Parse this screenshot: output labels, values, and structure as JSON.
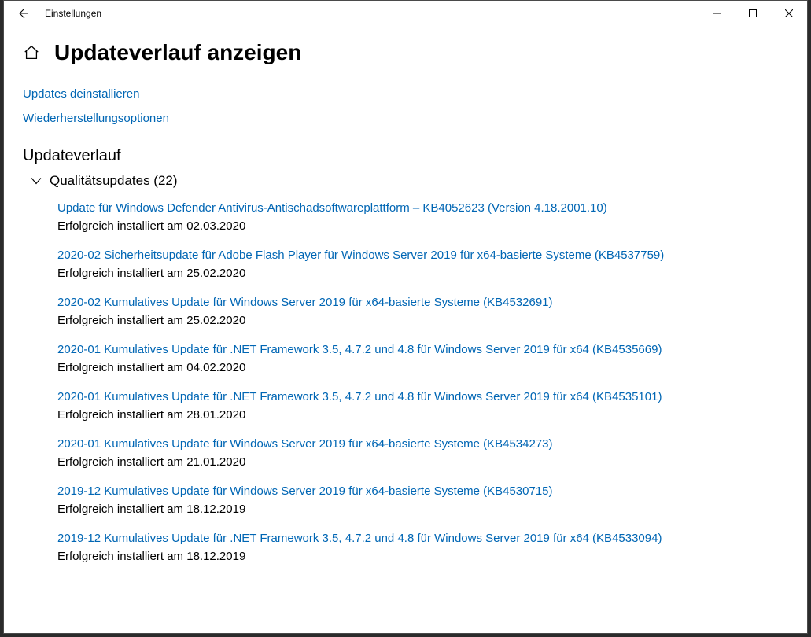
{
  "window": {
    "title": "Einstellungen"
  },
  "page": {
    "heading": "Updateverlauf anzeigen"
  },
  "links": {
    "uninstall": "Updates deinstallieren",
    "recovery": "Wiederherstellungsoptionen"
  },
  "history": {
    "heading": "Updateverlauf",
    "group_label": "Qualitätsupdates (22)",
    "items": [
      {
        "title": "Update für Windows Defender Antivirus-Antischadsoftwareplattform – KB4052623 (Version 4.18.2001.10)",
        "status": "Erfolgreich installiert am 02.03.2020"
      },
      {
        "title": "2020-02 Sicherheitsupdate für Adobe Flash Player für Windows Server 2019 für x64-basierte Systeme (KB4537759)",
        "status": "Erfolgreich installiert am 25.02.2020"
      },
      {
        "title": "2020-02 Kumulatives Update für Windows Server 2019 für x64-basierte Systeme (KB4532691)",
        "status": "Erfolgreich installiert am 25.02.2020"
      },
      {
        "title": "2020-01 Kumulatives Update für .NET Framework 3.5, 4.7.2 und 4.8 für Windows Server 2019 für x64 (KB4535669)",
        "status": "Erfolgreich installiert am 04.02.2020"
      },
      {
        "title": "2020-01 Kumulatives Update für .NET Framework 3.5, 4.7.2 und 4.8 für Windows Server 2019 für x64 (KB4535101)",
        "status": "Erfolgreich installiert am 28.01.2020"
      },
      {
        "title": "2020-01 Kumulatives Update für Windows Server 2019 für x64-basierte Systeme (KB4534273)",
        "status": "Erfolgreich installiert am 21.01.2020"
      },
      {
        "title": "2019-12 Kumulatives Update für Windows Server 2019 für x64-basierte Systeme (KB4530715)",
        "status": "Erfolgreich installiert am 18.12.2019"
      },
      {
        "title": "2019-12 Kumulatives Update für .NET Framework 3.5, 4.7.2 und 4.8 für Windows Server 2019 für x64 (KB4533094)",
        "status": "Erfolgreich installiert am 18.12.2019"
      }
    ]
  }
}
